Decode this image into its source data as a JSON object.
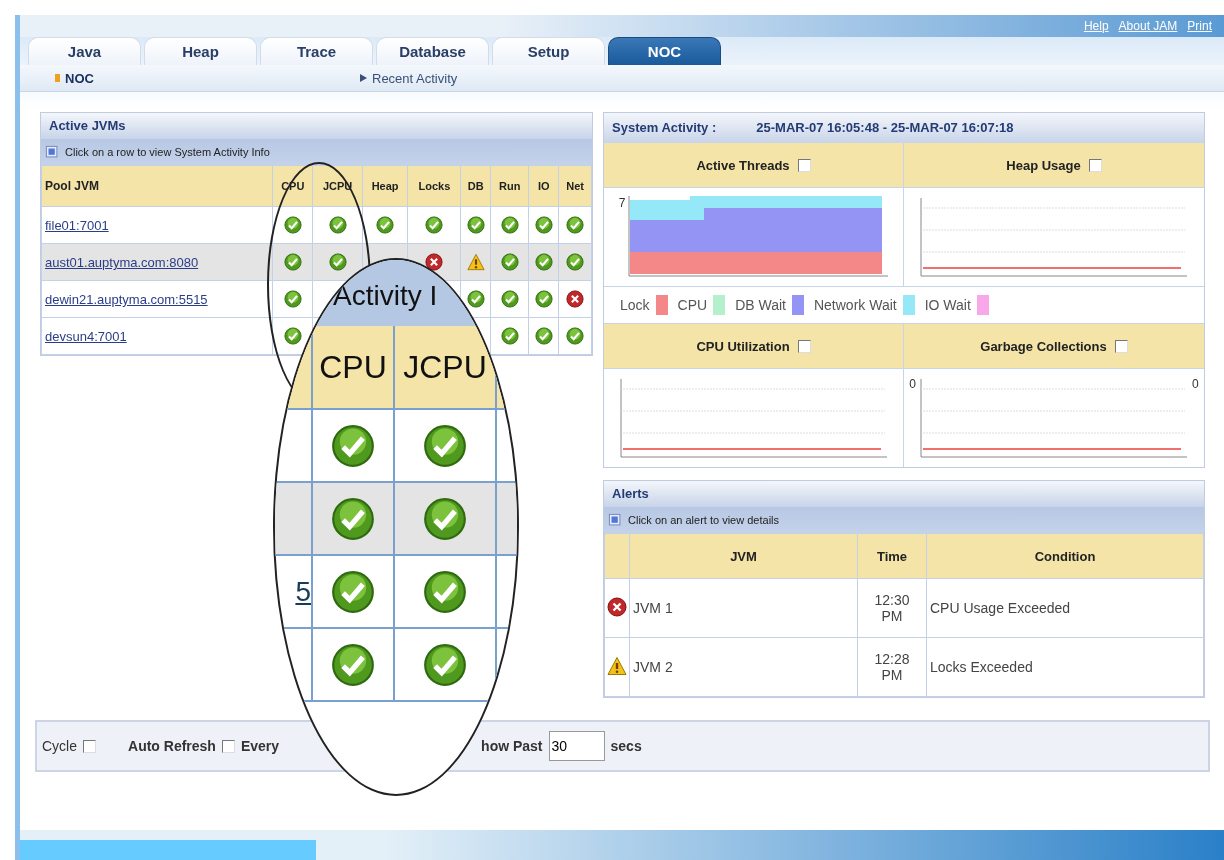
{
  "header_links": [
    {
      "label": "Help"
    },
    {
      "label": "About JAM"
    },
    {
      "label": "Print"
    }
  ],
  "tabs": [
    {
      "label": "Java",
      "selected": false
    },
    {
      "label": "Heap",
      "selected": false
    },
    {
      "label": "Trace",
      "selected": false
    },
    {
      "label": "Database",
      "selected": false
    },
    {
      "label": "Setup",
      "selected": false
    },
    {
      "label": "NOC",
      "selected": true
    }
  ],
  "subnav": [
    {
      "label": "NOC",
      "selected": true
    },
    {
      "label": "Recent Activity",
      "selected": false
    }
  ],
  "active_jvms": {
    "title": "Active JVMs",
    "hint": "Click on a row to view System Activity Info",
    "columns": [
      "Pool JVM",
      "CPU",
      "JCPU",
      "Heap",
      "Locks",
      "DB",
      "Run",
      "IO",
      "Net"
    ],
    "rows": [
      {
        "name": "file01:7001",
        "selected": false,
        "status": {
          "cpu": {
            "kind": "ok"
          },
          "jcpu": {
            "kind": "ok"
          },
          "heap": {
            "kind": "ok"
          },
          "locks": {
            "kind": "ok"
          },
          "db": {
            "kind": "ok"
          },
          "run": {
            "kind": "ok"
          },
          "io": {
            "kind": "ok"
          },
          "net": {
            "kind": "ok"
          }
        }
      },
      {
        "name": "aust01.auptyma.com:8080",
        "selected": true,
        "status": {
          "cpu": {
            "kind": "ok"
          },
          "jcpu": {
            "kind": "ok"
          },
          "locks": {
            "kind": "error"
          },
          "db": {
            "kind": "warn"
          },
          "run": {
            "kind": "ok"
          },
          "io": {
            "kind": "ok"
          },
          "net": {
            "kind": "ok"
          }
        }
      },
      {
        "name": "dewin21.auptyma.com:5515",
        "selected": false,
        "status": {
          "cpu": {
            "kind": "ok"
          },
          "db": {
            "kind": "ok"
          },
          "run": {
            "kind": "ok"
          },
          "io": {
            "kind": "ok"
          },
          "net": {
            "kind": "error"
          }
        }
      },
      {
        "name": "devsun4:7001",
        "selected": false,
        "status": {
          "cpu": {
            "kind": "ok"
          },
          "run": {
            "kind": "ok"
          },
          "io": {
            "kind": "ok"
          },
          "net": {
            "kind": "ok"
          }
        }
      }
    ]
  },
  "system_activity": {
    "title": "System Activity :",
    "range": "25-MAR-07 16:05:48 - 25-MAR-07 16:07:18",
    "charts": [
      {
        "title": "Active Threads",
        "checked": false,
        "kind": "stacked",
        "left_label": "7"
      },
      {
        "title": "Heap Usage",
        "checked": false,
        "kind": "line"
      },
      {
        "title": "CPU Utilization",
        "checked": false,
        "kind": "line"
      },
      {
        "title": "Garbage Collections",
        "checked": false,
        "kind": "line",
        "left_label": "0",
        "right_label": "0"
      }
    ],
    "legend": [
      {
        "label": "Lock",
        "color": "#f48888"
      },
      {
        "label": "CPU",
        "color": "#b4f0cc"
      },
      {
        "label": "DB Wait",
        "color": "#9494f4"
      },
      {
        "label": "Network Wait",
        "color": "#94e8f8"
      },
      {
        "label": "IO Wait",
        "color": "#f8a8e8"
      }
    ]
  },
  "alerts": {
    "title": "Alerts",
    "hint": "Click on an alert to view details",
    "columns": [
      "JVM",
      "Time",
      "Condition"
    ],
    "rows": [
      {
        "kind": "error",
        "jvm": "JVM 1",
        "time": "12:30 PM",
        "condition": "CPU Usage Exceeded"
      },
      {
        "kind": "warn",
        "jvm": "JVM 2",
        "time": "12:28 PM",
        "condition": "Locks Exceeded"
      }
    ]
  },
  "controls": {
    "cycle": {
      "label": "Cycle",
      "checked": false
    },
    "auto_refresh": {
      "label": "Auto Refresh",
      "checked": false
    },
    "every_label": "Every",
    "show_past_label": "how Past",
    "show_past_value": "30",
    "units": "secs"
  },
  "magnifier": {
    "title": "Activity I",
    "columns": [
      "CPU",
      "JCPU"
    ],
    "rows": [
      {
        "selected": false,
        "status": [
          {
            "kind": "ok"
          },
          {
            "kind": "ok"
          }
        ]
      },
      {
        "selected": true,
        "status": [
          {
            "kind": "ok"
          },
          {
            "kind": "ok"
          }
        ]
      },
      {
        "selected": false,
        "fragment": "5",
        "status": [
          {
            "kind": "ok"
          },
          {
            "kind": "ok"
          }
        ]
      },
      {
        "selected": false,
        "status": [
          {
            "kind": "ok"
          },
          {
            "kind": "ok"
          }
        ]
      }
    ]
  }
}
